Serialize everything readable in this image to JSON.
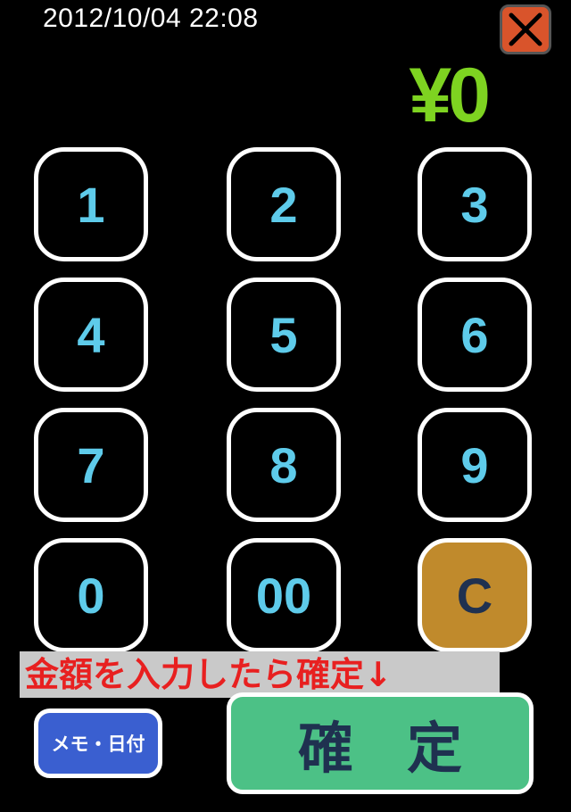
{
  "header": {
    "datetime": "2012/10/04 22:08",
    "close_icon": "close-x-icon"
  },
  "display": {
    "amount": "¥0"
  },
  "keypad": {
    "keys": [
      "1",
      "2",
      "3",
      "4",
      "5",
      "6",
      "7",
      "8",
      "9",
      "0",
      "00",
      "C"
    ]
  },
  "hint": "金額を入力したら確定↓",
  "buttons": {
    "memo_date": "メモ・日付",
    "confirm": "確定"
  },
  "colors": {
    "background": "#000000",
    "amount": "#7ed321",
    "key_text": "#5ecbea",
    "clear_key": "#c08a2c",
    "close_button": "#d9542b",
    "hint_text": "#e82020",
    "memo_button": "#3a5fd0",
    "confirm_button": "#4cc186"
  }
}
